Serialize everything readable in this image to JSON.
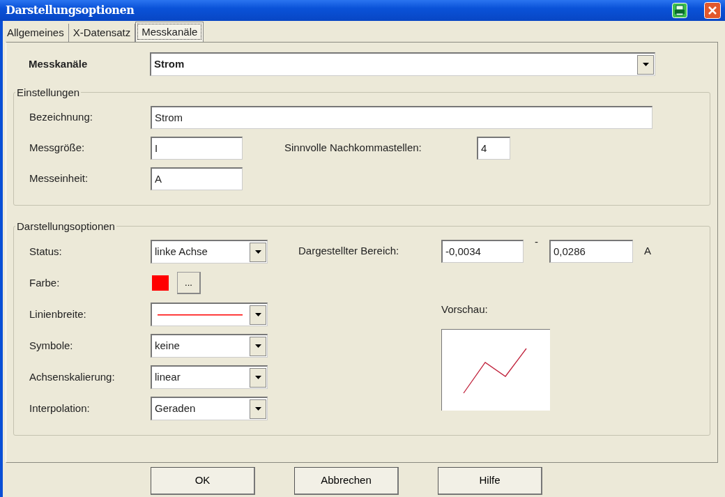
{
  "window": {
    "title": "Darstellungsoptionen"
  },
  "tabs": [
    {
      "label": "Allgemeines",
      "selected": false
    },
    {
      "label": "X-Datensatz",
      "selected": false
    },
    {
      "label": "Messkanäle",
      "selected": true
    }
  ],
  "channel": {
    "label": "Messkanäle",
    "value": "Strom"
  },
  "einstellungen": {
    "title": "Einstellungen",
    "bezeichnung": {
      "label": "Bezeichnung:",
      "value": "Strom"
    },
    "messgroesse": {
      "label": "Messgröße:",
      "value": "I"
    },
    "messeinheit": {
      "label": "Messeinheit:",
      "value": "A"
    },
    "nachkommastellen": {
      "label": "Sinnvolle Nachkommastellen:",
      "value": "4"
    }
  },
  "darstellung": {
    "title": "Darstellungsoptionen",
    "rows": [
      {
        "kind": "select",
        "label": "Status:",
        "value": "linke Achse"
      },
      {
        "kind": "color",
        "label": "Farbe:",
        "color": "#ff0000",
        "button": "..."
      },
      {
        "kind": "line",
        "label": "Linienbreite:"
      },
      {
        "kind": "select",
        "label": "Symbole:",
        "value": "keine"
      },
      {
        "kind": "select",
        "label": "Achsenskalierung:",
        "value": "linear"
      },
      {
        "kind": "select",
        "label": "Interpolation:",
        "value": "Geraden"
      }
    ],
    "bereich": {
      "label": "Dargestellter Bereich:",
      "from": "-0,0034",
      "separator": "-",
      "to": "0,0286",
      "unit": "A"
    },
    "vorschau": {
      "label": "Vorschau:"
    }
  },
  "buttons": [
    "OK",
    "Abbrechen",
    "Hilfe"
  ]
}
